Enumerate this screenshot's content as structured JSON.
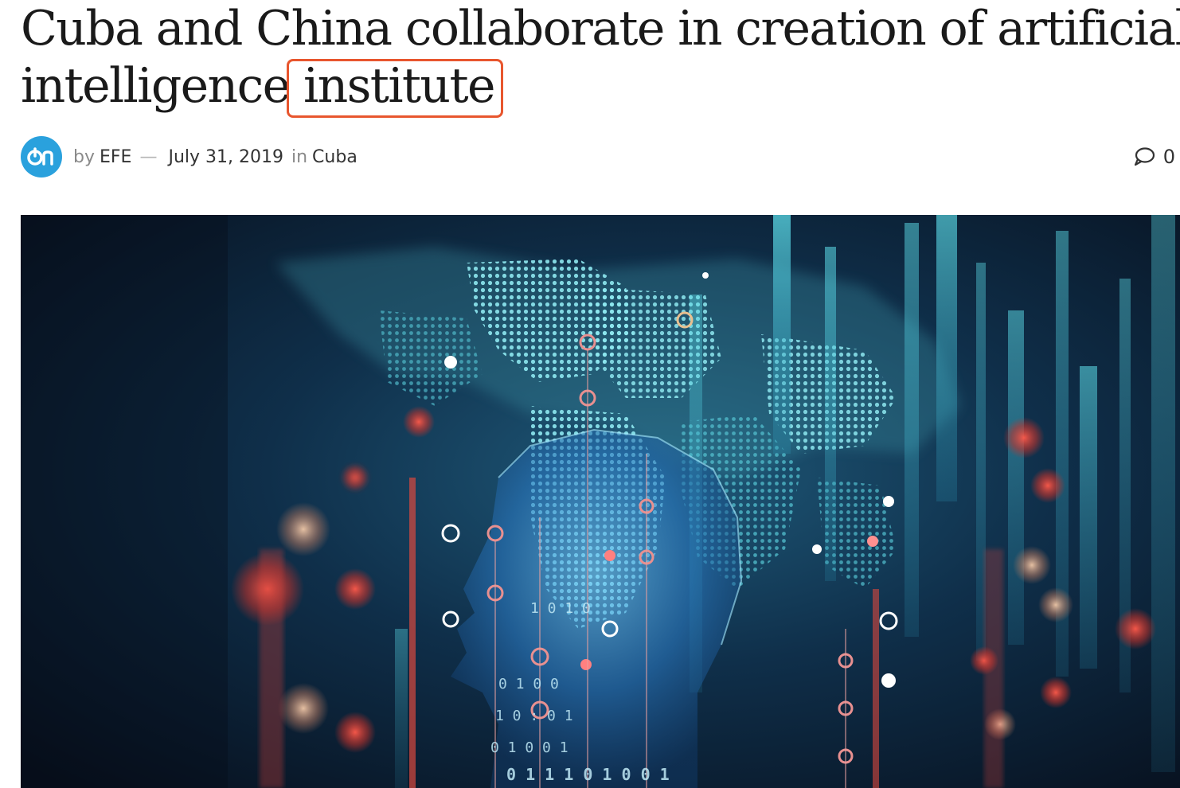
{
  "article": {
    "title_line1": "Cuba and China collaborate in creation of artificial",
    "title_line2_prefix": "intelligence",
    "title_line2_highlight": "institute"
  },
  "meta": {
    "avatar_text": "On",
    "by_label": "by",
    "author": "EFE",
    "separator": "—",
    "date": "July 31, 2019",
    "in_label": "in",
    "category": "Cuba",
    "comment_count": "0"
  },
  "hero": {
    "binary_text_1": "0 1 0 0 1",
    "binary_text_2": "0 1 1 1 0 1 0 0 1",
    "binary_text_3": "1 0 : 0 1",
    "binary_text_4": "0 1 0 0",
    "binary_text_5": "1 0 1 0",
    "image_note_colors": {
      "background": "#0a1a2e",
      "cyan": "#3fd0e0",
      "red": "#e0443a"
    }
  }
}
